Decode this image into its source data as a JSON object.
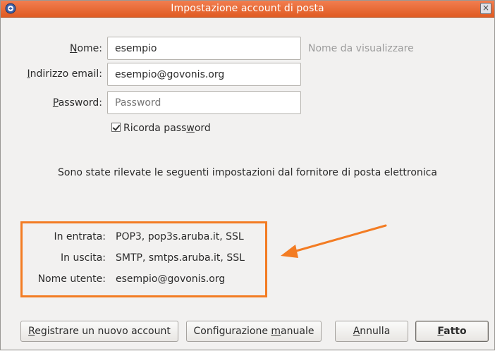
{
  "window": {
    "title": "Impostazione account di posta",
    "close_glyph": "×"
  },
  "form": {
    "name_label_key": "N",
    "name_label_rest": "ome:",
    "name_value": "esempio",
    "name_hint": "Nome da visualizzare",
    "email_label_key": "I",
    "email_label_rest": "ndirizzo email:",
    "email_value": "esempio@govonis.org",
    "password_label_key": "P",
    "password_label_rest": "assword:",
    "password_placeholder": "Password",
    "remember_pre": "Ricorda pass",
    "remember_key": "w",
    "remember_post": "ord",
    "remember_checked": true
  },
  "detected_text": "Sono state rilevate le seguenti impostazioni dal fornitore di posta elettronica",
  "settings": {
    "incoming_label": "In entrata:",
    "incoming_value": "POP3, pop3s.aruba.it, SSL",
    "outgoing_label": "In uscita:",
    "outgoing_value": "SMTP, smtps.aruba.it, SSL",
    "username_label": "Nome utente:",
    "username_value": "esempio@govonis.org"
  },
  "buttons": {
    "register_key": "R",
    "register_rest": "egistrare un nuovo account",
    "manual_pre": "Configurazione ",
    "manual_key": "m",
    "manual_post": "anuale",
    "cancel_key": "A",
    "cancel_rest": "nnulla",
    "done_key": "F",
    "done_rest": "atto"
  },
  "colors": {
    "titlebar": "#e96a36",
    "highlight": "#f37c23",
    "background": "#f2f1f0"
  },
  "icons": {
    "app": "thunderbird-icon",
    "close": "close-icon",
    "arrow": "annotation-arrow"
  }
}
